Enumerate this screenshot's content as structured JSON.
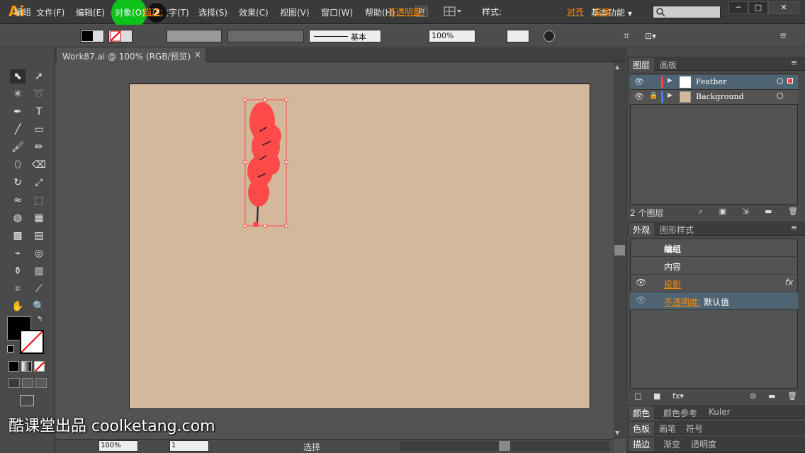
{
  "app": {
    "logo": "Ai",
    "br_button": "Br"
  },
  "menu": [
    "文件(F)",
    "编辑(E)",
    "对象(O)",
    "文字(T)",
    "选择(S)",
    "效果(C)",
    "视图(V)",
    "窗口(W)",
    "帮助(H)"
  ],
  "step_badge": "2",
  "workspace": "基本功能",
  "window_buttons": [
    "─",
    "□",
    "✕"
  ],
  "control": {
    "selection": "编组",
    "stroke_label": "描边:",
    "stroke_style": "基本",
    "opacity_label": "不透明度:",
    "opacity_value": "100%",
    "style_label": "样式:",
    "align": "对齐",
    "transform": "变换"
  },
  "document_tab": {
    "title": "Work87.ai @ 100% (RGB/预览)",
    "close": "×"
  },
  "layers_panel": {
    "tabs": [
      "图层",
      "画板"
    ],
    "layers": [
      {
        "name": "Feather",
        "color": "#ff4040"
      },
      {
        "name": "Background",
        "color": "#3f7fff"
      }
    ],
    "count": "2 个图层"
  },
  "appearance_panel": {
    "tabs": [
      "外观",
      "图形样式"
    ],
    "group": "编组",
    "contents": "内容",
    "effect": "投影",
    "effect_fx": "fx",
    "opacity_label": "不透明度:",
    "opacity_value": "默认值"
  },
  "bottom_panels": {
    "row1": [
      "颜色",
      "颜色参考",
      "Kuler"
    ],
    "row2": [
      "色板",
      "画笔",
      "符号"
    ],
    "row3": [
      "描边",
      "渐变",
      "透明度"
    ]
  },
  "status": {
    "zoom": "100%",
    "page": "1",
    "tool": "选择"
  },
  "watermark": "酷课堂出品 coolketang.com",
  "colors": {
    "accent": "#ff8a00",
    "highlight": "#0cc21b",
    "selection": "#ff4a4a",
    "artboard": "#d4b89c"
  }
}
